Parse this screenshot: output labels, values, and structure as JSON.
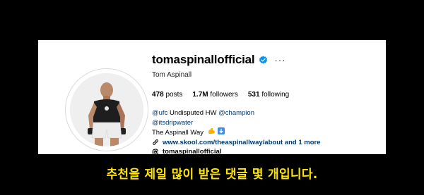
{
  "profile": {
    "username": "tomaspinallofficial",
    "more_label": "···",
    "full_name": "Tom Aspinall",
    "stats": [
      {
        "count": "478",
        "label": "posts"
      },
      {
        "count": "1.7M",
        "label": "followers"
      },
      {
        "count": "531",
        "label": "following"
      }
    ],
    "bio": {
      "line1_mention1": "@ufc",
      "line1_text": " Undisputed HW ",
      "line1_mention2": "@champion",
      "line2_mention": "@itsdripwater",
      "line3_text": "The Aspinall Way",
      "link_text": "www.skool.com/theaspinallway/about and 1 more",
      "threads_handle": "tomaspinallofficial"
    },
    "colors": {
      "verified": "#0095f6",
      "link": "#00376b"
    }
  },
  "subtitle": "추천을 제일 많이 받은 댓글 몇 개입니다.",
  "icons": [
    "verified-badge-icon",
    "more-options-icon",
    "link-icon",
    "threads-icon",
    "flexed-biceps-emoji-icon",
    "down-arrow-emoji-icon"
  ]
}
